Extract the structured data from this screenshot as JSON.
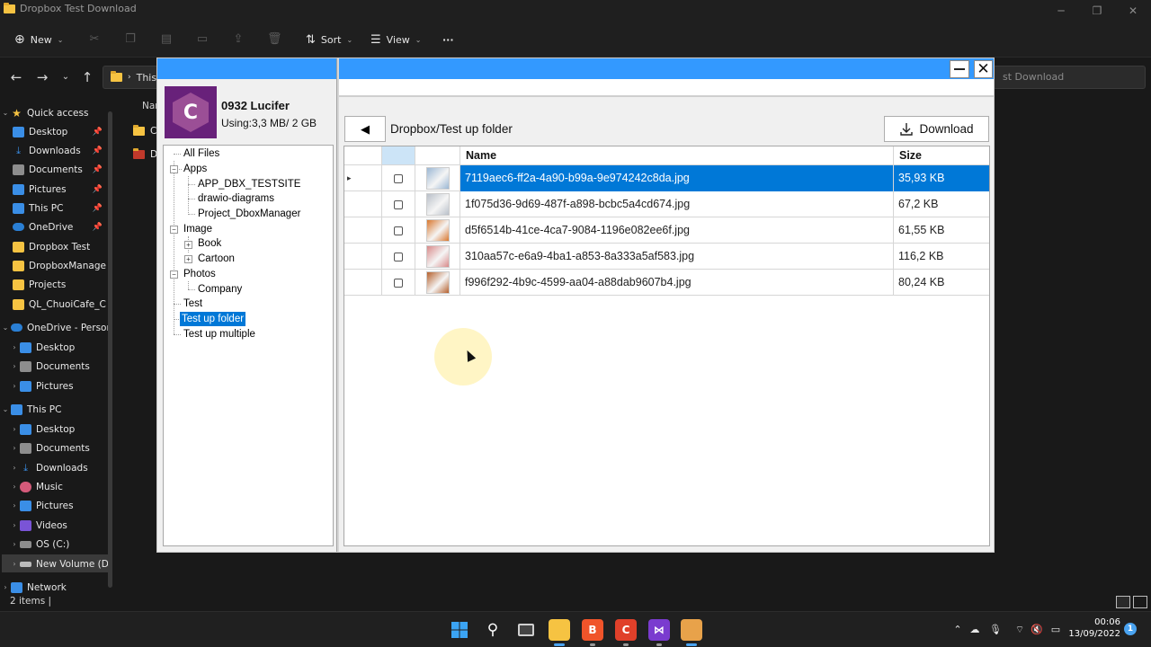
{
  "explorer": {
    "window_title": "Dropbox Test Download",
    "command_bar": {
      "new_label": "New",
      "sort_label": "Sort",
      "view_label": "View",
      "more_label": "···"
    },
    "address_text": "This",
    "search_placeholder": "st Download",
    "columns_partial": "Nar",
    "files_partial": [
      "Ca",
      "Dr"
    ],
    "nav": {
      "quick_access": "Quick access",
      "quick_items": [
        "Desktop",
        "Downloads",
        "Documents",
        "Pictures",
        "This PC",
        "OneDrive",
        "Dropbox Test",
        "DropboxManage",
        "Projects",
        "QL_ChuoiCafe_C"
      ],
      "onedrive": "OneDrive - Person",
      "onedrive_items": [
        "Desktop",
        "Documents",
        "Pictures"
      ],
      "this_pc": "This PC",
      "pc_items": [
        "Desktop",
        "Documents",
        "Downloads",
        "Music",
        "Pictures",
        "Videos",
        "OS (C:)",
        "New Volume (D:"
      ],
      "network": "Network"
    },
    "status": "2 items  |"
  },
  "app": {
    "account": {
      "name": "0932 Lucifer",
      "usage": "Using:3,3 MB/ 2 GB",
      "avatar_letter": "C"
    },
    "tree": {
      "all_files": "All Files",
      "apps": "Apps",
      "apps_children": [
        "APP_DBX_TESTSITE",
        "drawio-diagrams",
        "Project_DboxManager"
      ],
      "image": "Image",
      "image_children": [
        "Book",
        "Cartoon"
      ],
      "photos": "Photos",
      "photos_children": [
        "Company"
      ],
      "test": "Test",
      "test_up_folder": "Test up folder",
      "test_up_multiple": "Test up multiple"
    },
    "back_label": "◀",
    "path": "Dropbox/Test up folder",
    "download_label": "Download",
    "grid": {
      "headers": {
        "name": "Name",
        "size": "Size"
      },
      "rows": [
        {
          "name": "7119aec6-ff2a-4a90-b99a-9e974242c8da.jpg",
          "size": "35,93 KB",
          "selected": true,
          "thumb_color": "#9bb7d4"
        },
        {
          "name": "1f075d36-9d69-487f-a898-bcbc5a4cd674.jpg",
          "size": "67,2 KB",
          "selected": false,
          "thumb_color": "#b9c0c9"
        },
        {
          "name": "d5f6514b-41ce-4ca7-9084-1196e082ee6f.jpg",
          "size": "61,55 KB",
          "selected": false,
          "thumb_color": "#d9772e"
        },
        {
          "name": "310aa57c-e6a9-4ba1-a853-8a333a5af583.jpg",
          "size": "116,2 KB",
          "selected": false,
          "thumb_color": "#d98a8a"
        },
        {
          "name": "f996f292-4b9c-4599-aa04-a88dab9607b4.jpg",
          "size": "80,24 KB",
          "selected": false,
          "thumb_color": "#b5602c"
        }
      ]
    }
  },
  "taskbar": {
    "time": "00:06",
    "date": "13/09/2022",
    "notification_count": "1"
  },
  "colors": {
    "accent": "#3399ff",
    "selection": "#0078d7"
  }
}
